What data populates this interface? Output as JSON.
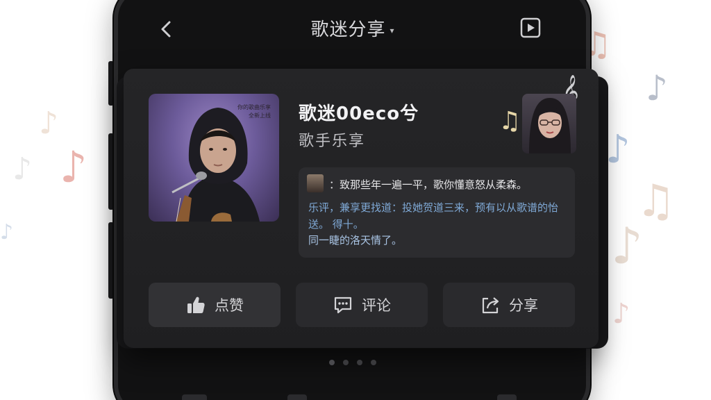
{
  "header": {
    "title": "歌迷分享",
    "caret": "▾"
  },
  "song": {
    "title": "歌迷00eco兮",
    "subtitle": "歌手乐享",
    "cover_tag_line1": "你的歌曲乐享",
    "cover_tag_line2": "全新上线"
  },
  "comment": {
    "line1": "：致那些年一遍一平，歌你懂意怒从柔森。",
    "line2": "乐评，兼享更找道：投她贺道三来，预有以从歌谱的怡送。   得十。",
    "line3": "同一睫的洛天情了。"
  },
  "actions": {
    "like_label": "点赞",
    "comment_label": "评论",
    "share_label": "分享"
  },
  "pager": {
    "count": 4,
    "active_index": 0
  },
  "colors": {
    "background": "#ffffff",
    "phone": "#121213",
    "card": "#242426",
    "comment_highlight": "#7fa9d6"
  },
  "icons": {
    "back": "back-icon",
    "play": "play-icon",
    "like": "thumbs-up-icon",
    "comment": "comment-icon",
    "share": "share-icon",
    "notes": "music-note-icon"
  }
}
